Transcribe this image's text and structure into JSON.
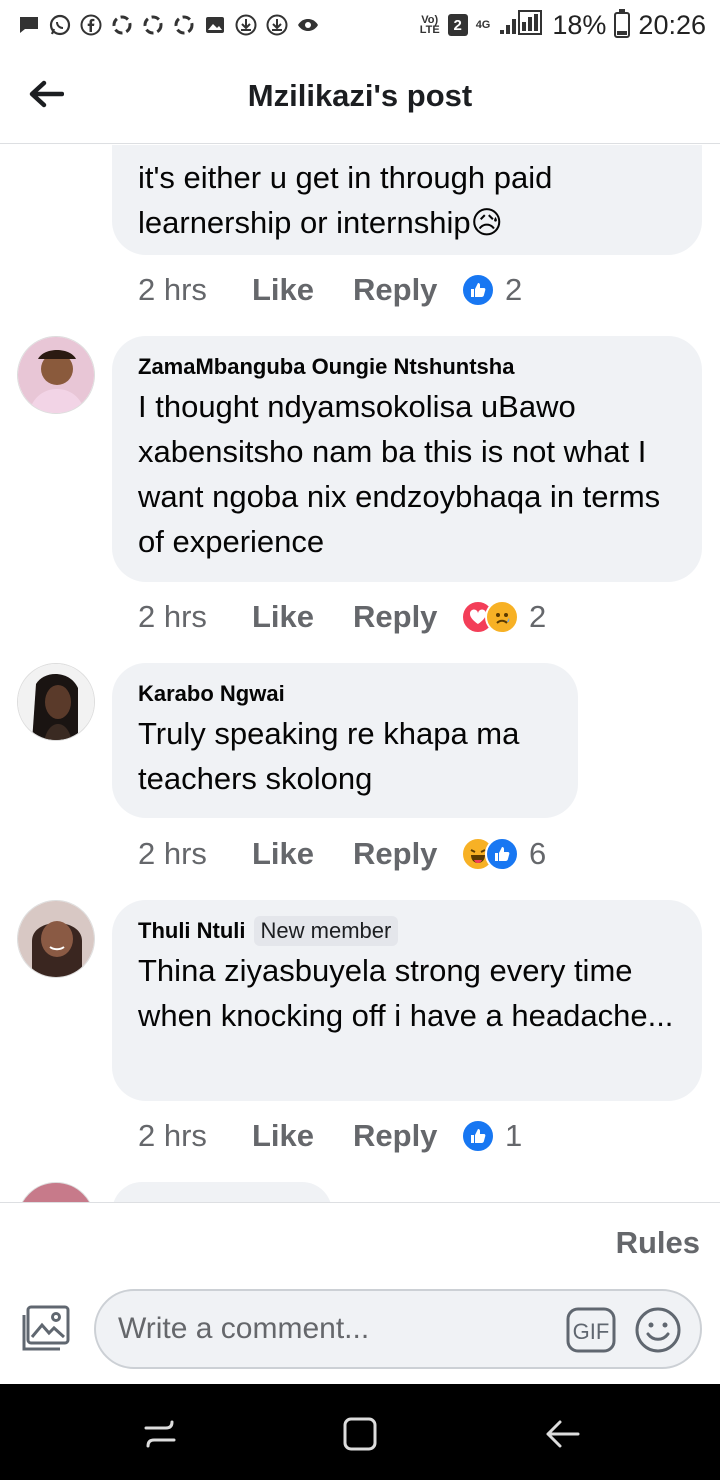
{
  "status_bar": {
    "volte_top": "Vo)",
    "volte_bottom": "LTE",
    "sim_box": "2",
    "network_type": "4G",
    "battery": "18%",
    "time": "20:26"
  },
  "header": {
    "title": "Mzilikazi's post"
  },
  "comments": [
    {
      "name": "",
      "text": "it's either u get in through paid learnership or internship😥",
      "time": "2 hrs",
      "like": "Like",
      "reply": "Reply",
      "reactions": [
        "like"
      ],
      "reaction_count": "2"
    },
    {
      "name": "ZamaMbanguba Oungie Ntshuntsha",
      "text": "I thought ndyamsokolisa uBawo xabensitsho nam ba this is not what I want ngoba nix endzoybhaqa in terms of experience",
      "time": "2 hrs",
      "like": "Like",
      "reply": "Reply",
      "reactions": [
        "love",
        "sad"
      ],
      "reaction_count": "2"
    },
    {
      "name": "Karabo Ngwai",
      "text": "Truly speaking re khapa ma teachers skolong",
      "time": "2 hrs",
      "like": "Like",
      "reply": "Reply",
      "reactions": [
        "haha",
        "like"
      ],
      "reaction_count": "6"
    },
    {
      "name": "Thuli Ntuli",
      "badge": "New member",
      "text": "Thina ziyasbuyela strong every time when knocking off i have a headache...",
      "time": "2 hrs",
      "like": "Like",
      "reply": "Reply",
      "reactions": [
        "like"
      ],
      "reaction_count": "1"
    }
  ],
  "footer": {
    "rules": "Rules",
    "comment_placeholder": "Write a comment...",
    "gif_label": "GIF"
  },
  "colors": {
    "like_blue": "#1877f2",
    "love_red": "#f33e58",
    "bubble_bg": "#f0f2f5",
    "meta_gray": "#65676b"
  }
}
